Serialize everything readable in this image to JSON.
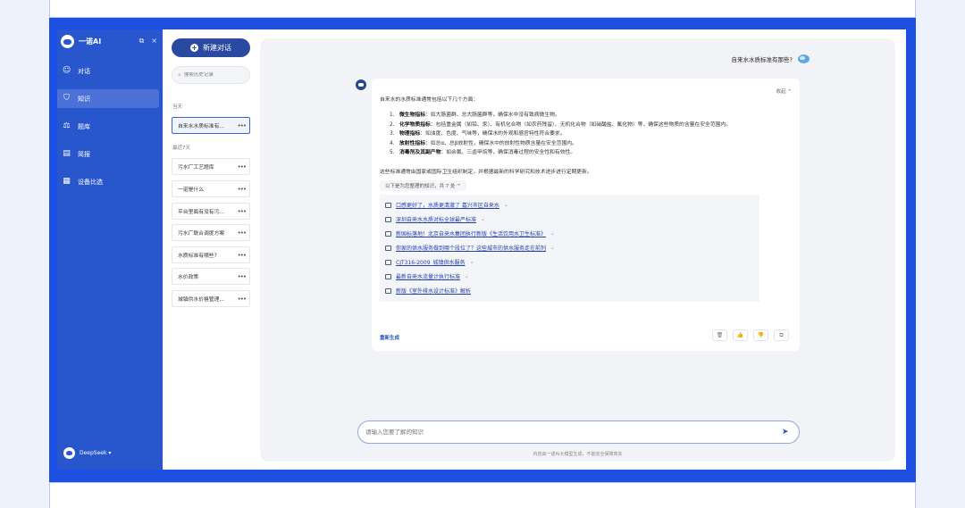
{
  "app": {
    "title": "一诺AI",
    "window_actions": [
      "⧉",
      "×"
    ]
  },
  "sidebar": {
    "items": [
      {
        "label": "对话",
        "icon": "chat-icon"
      },
      {
        "label": "知识",
        "icon": "knowledge-icon",
        "active": true
      },
      {
        "label": "题库",
        "icon": "question-bank-icon"
      },
      {
        "label": "简报",
        "icon": "briefing-icon"
      },
      {
        "label": "设备比选",
        "icon": "device-compare-icon"
      }
    ],
    "model": "DeepSeek ▾"
  },
  "history": {
    "new_chat_label": "新建对话",
    "search_placeholder": "搜索历史记录",
    "today_label": "当天",
    "today_items": [
      "自来水水质标准有..."
    ],
    "week_label": "最近7天",
    "week_items": [
      "污水厂工艺题库",
      "一诺是什么",
      "平台里面有没有污...",
      "污水厂联合调度方案",
      "水质标准有哪些?",
      "水价政策",
      "城镇供水价格管理..."
    ]
  },
  "chat": {
    "question": "自来水水质标准有那些?",
    "collapse_label": "收起 ^",
    "intro": "自来水的水质标准通常包括以下几个方面：",
    "points": [
      {
        "n": "1.",
        "title": "微生物指标",
        "text": "：如大肠菌群、总大肠菌群等，确保水中没有致病微生物。"
      },
      {
        "n": "2.",
        "title": "化学物质指标",
        "text": "：包括重金属（如铅、汞）、有机化合物（如农药残留）、无机化合物（如硝酸盐、氟化物）等，确保这些物质的含量在安全范围内。"
      },
      {
        "n": "3.",
        "title": "物理指标",
        "text": "：如浊度、色度、气味等，确保水的外观和感官特性符合要求。"
      },
      {
        "n": "4.",
        "title": "放射性指标",
        "text": "：如总α、总β放射性，确保水中的放射性物质含量在安全范围内。"
      },
      {
        "n": "5.",
        "title": "消毒剂及其副产物",
        "text": "：如余氯、三卤甲烷等，确保消毒过程的安全性和有效性。"
      }
    ],
    "summary": "这些标准通常由国家或国际卫生组织制定，并根据最新的科学研究和技术进步进行定期更新。",
    "kb_toggle": "以下是为您整理的知识，共 7 处 ^",
    "references": [
      "口感更好了，水质更清澈了 嘉兴市区自来水",
      "深圳自来水水质对标全球最严标准",
      "新国标落地！北京自来水集团执行新版《生活饮用水卫生标准》",
      "你家的供水服务做到哪个段位了？这些城市的供水服务走在前列",
      "CJT316-2009_城镇供水服务",
      "最新自来水流量计执行标准",
      "新版《室外排水设计标准》解析"
    ],
    "regenerate_label": "重新生成",
    "actions": [
      "🗑",
      "👍",
      "👎",
      "⧉"
    ]
  },
  "input": {
    "placeholder": "请输入您要了解的知识",
    "send_icon": "➤",
    "disclaimer": "内容由一诺AI大模型生成，不能完全保障真实"
  }
}
